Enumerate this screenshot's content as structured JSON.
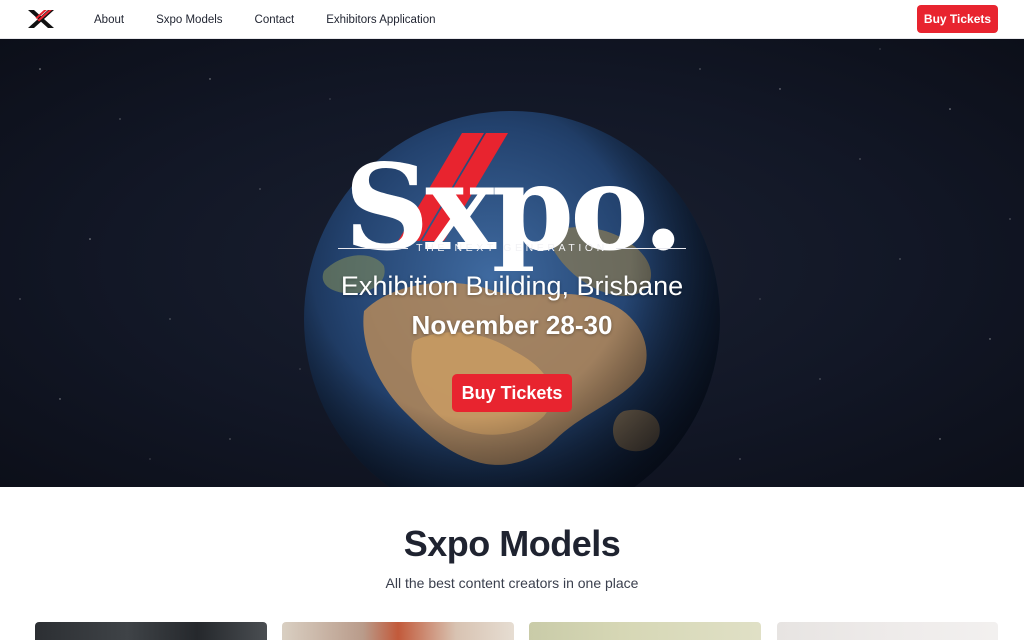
{
  "nav": {
    "logo_icon": "sxpo-x-icon",
    "links": [
      "About",
      "Sxpo Models",
      "Contact",
      "Exhibitors Application"
    ],
    "buy_label": "Buy Tickets"
  },
  "hero": {
    "logo_text": "Sxpo.",
    "tagline": "THE NEXT GENERATION",
    "venue": "Exhibition Building, Brisbane",
    "dates": "November 28-30",
    "buy_label": "Buy Tickets"
  },
  "models": {
    "title": "Sxpo Models",
    "subtitle": "All the best content creators in one place"
  },
  "colors": {
    "accent": "#e8242f",
    "hero_bg": "#121726",
    "text": "#1f2330"
  }
}
